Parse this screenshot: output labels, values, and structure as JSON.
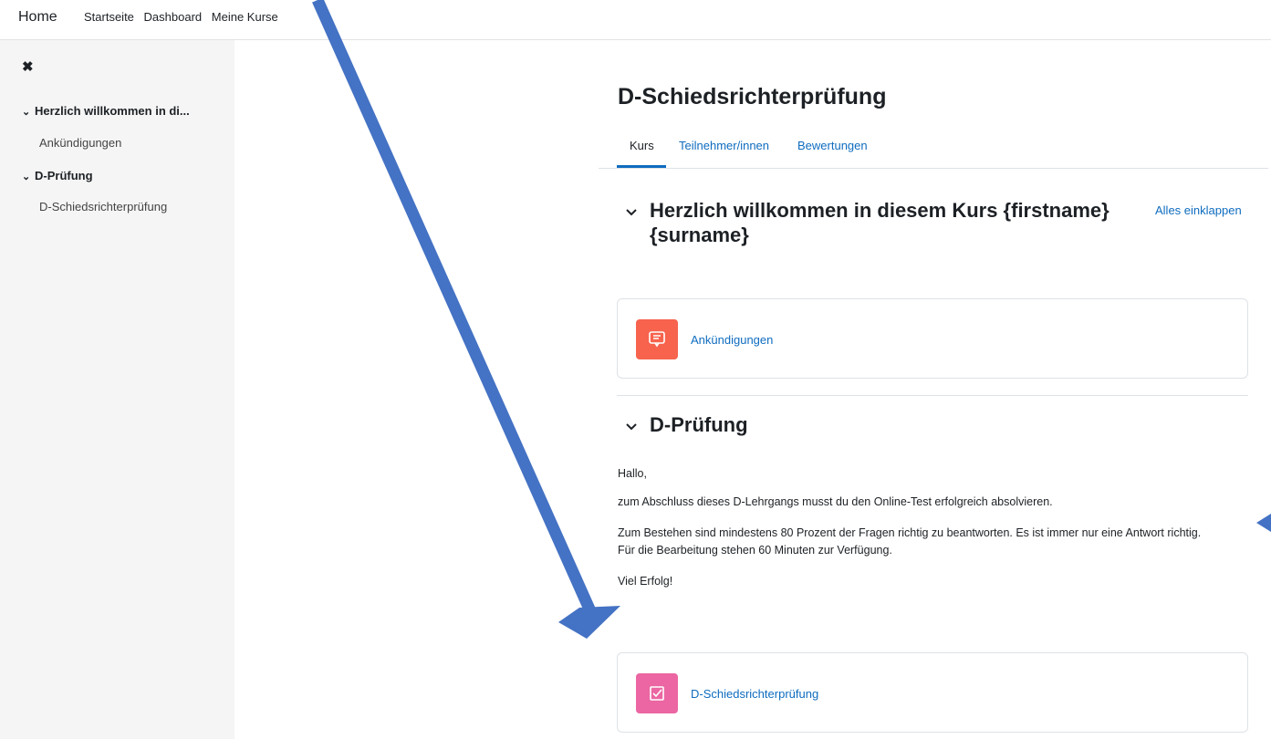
{
  "topnav": {
    "home": "Home",
    "links": [
      "Startseite",
      "Dashboard",
      "Meine Kurse"
    ]
  },
  "sidebar": {
    "close_icon": "close-icon",
    "items": [
      {
        "label": "Herzlich willkommen in di...",
        "type": "section"
      },
      {
        "label": "Ankündigungen",
        "type": "item"
      },
      {
        "label": "D-Prüfung",
        "type": "section"
      },
      {
        "label": "D-Schiedsrichterprüfung",
        "type": "item"
      }
    ]
  },
  "course": {
    "title": "D-Schiedsrichterprüfung",
    "tabs": [
      {
        "label": "Kurs",
        "active": true
      },
      {
        "label": "Teilnehmer/innen",
        "active": false
      },
      {
        "label": "Bewertungen",
        "active": false
      }
    ],
    "collapse_all": "Alles einklappen"
  },
  "sections": [
    {
      "title_line1": "Herzlich willkommen in diesem Kurs {firstname}",
      "title_line2": "{surname}",
      "activity": {
        "label": "Ankündigungen",
        "icon": "forum-icon",
        "color": "#f7634d"
      }
    },
    {
      "title": "D-Prüfung",
      "summary": [
        "Hallo,",
        "zum Abschluss dieses D-Lehrgangs musst du den Online-Test erfolgreich absolvieren.",
        "Zum Bestehen sind mindestens 80 Prozent der Fragen richtig zu beantworten. Es ist immer nur eine Antwort richtig.",
        "Für die Bearbeitung stehen 60 Minuten zur Verfügung.",
        "Viel Erfolg!"
      ],
      "activity": {
        "label": "D-Schiedsrichterprüfung",
        "icon": "quiz-icon",
        "color": "#eb66a2"
      }
    }
  ],
  "colors": {
    "link": "#0f6cbf",
    "annotation_arrow": "#4472c4"
  }
}
